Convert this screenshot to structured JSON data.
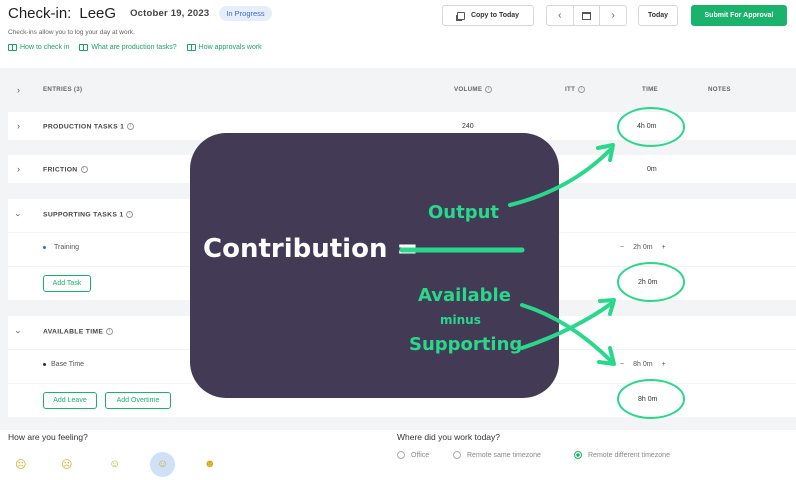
{
  "header": {
    "title": "Check-in:",
    "user": "LeeG",
    "date": "October 19, 2023",
    "status": "In Progress",
    "subtitle": "Check-ins allow you to log your day at work.",
    "help_links": [
      "How to check in",
      "What are production tasks?",
      "How approvals work"
    ],
    "copy_label": "Copy to Today",
    "prev": "‹",
    "next": "›",
    "today_label": "Today",
    "submit_label": "Submit For Approval"
  },
  "table": {
    "columns": {
      "entries": "ENTRIES (3)",
      "volume": "VOLUME",
      "itt": "ITT",
      "time": "TIME",
      "notes": "NOTES"
    },
    "production": {
      "label": "PRODUCTION TASKS 1",
      "volume": "240",
      "time": "4h 0m"
    },
    "friction": {
      "label": "FRICTION",
      "time": "0m"
    },
    "supporting": {
      "label": "SUPPORTING TASKS 1",
      "task": "Training",
      "task_time": "2h 0m",
      "add_task": "Add Task",
      "total": "2h 0m"
    },
    "available": {
      "label": "AVAILABLE TIME",
      "item": "Base Time",
      "item_time": "8h 0m",
      "add_leave": "Add Leave",
      "add_overtime": "Add Overtime",
      "total": "8h 0m"
    },
    "stepper": {
      "minus": "−",
      "plus": "+"
    }
  },
  "footer": {
    "feeling_q": "How are you feeling?",
    "where_q": "Where did you work today?",
    "where_options": [
      "Office",
      "Remote same timezone",
      "Remote different timezone"
    ],
    "selected_option": "Remote different timezone"
  },
  "annotation": {
    "contribution": "Contribution =",
    "output": "Output",
    "available": "Available",
    "minus": "minus",
    "supporting": "Supporting",
    "color": "#29d88a",
    "panel_color": "#433b56"
  }
}
